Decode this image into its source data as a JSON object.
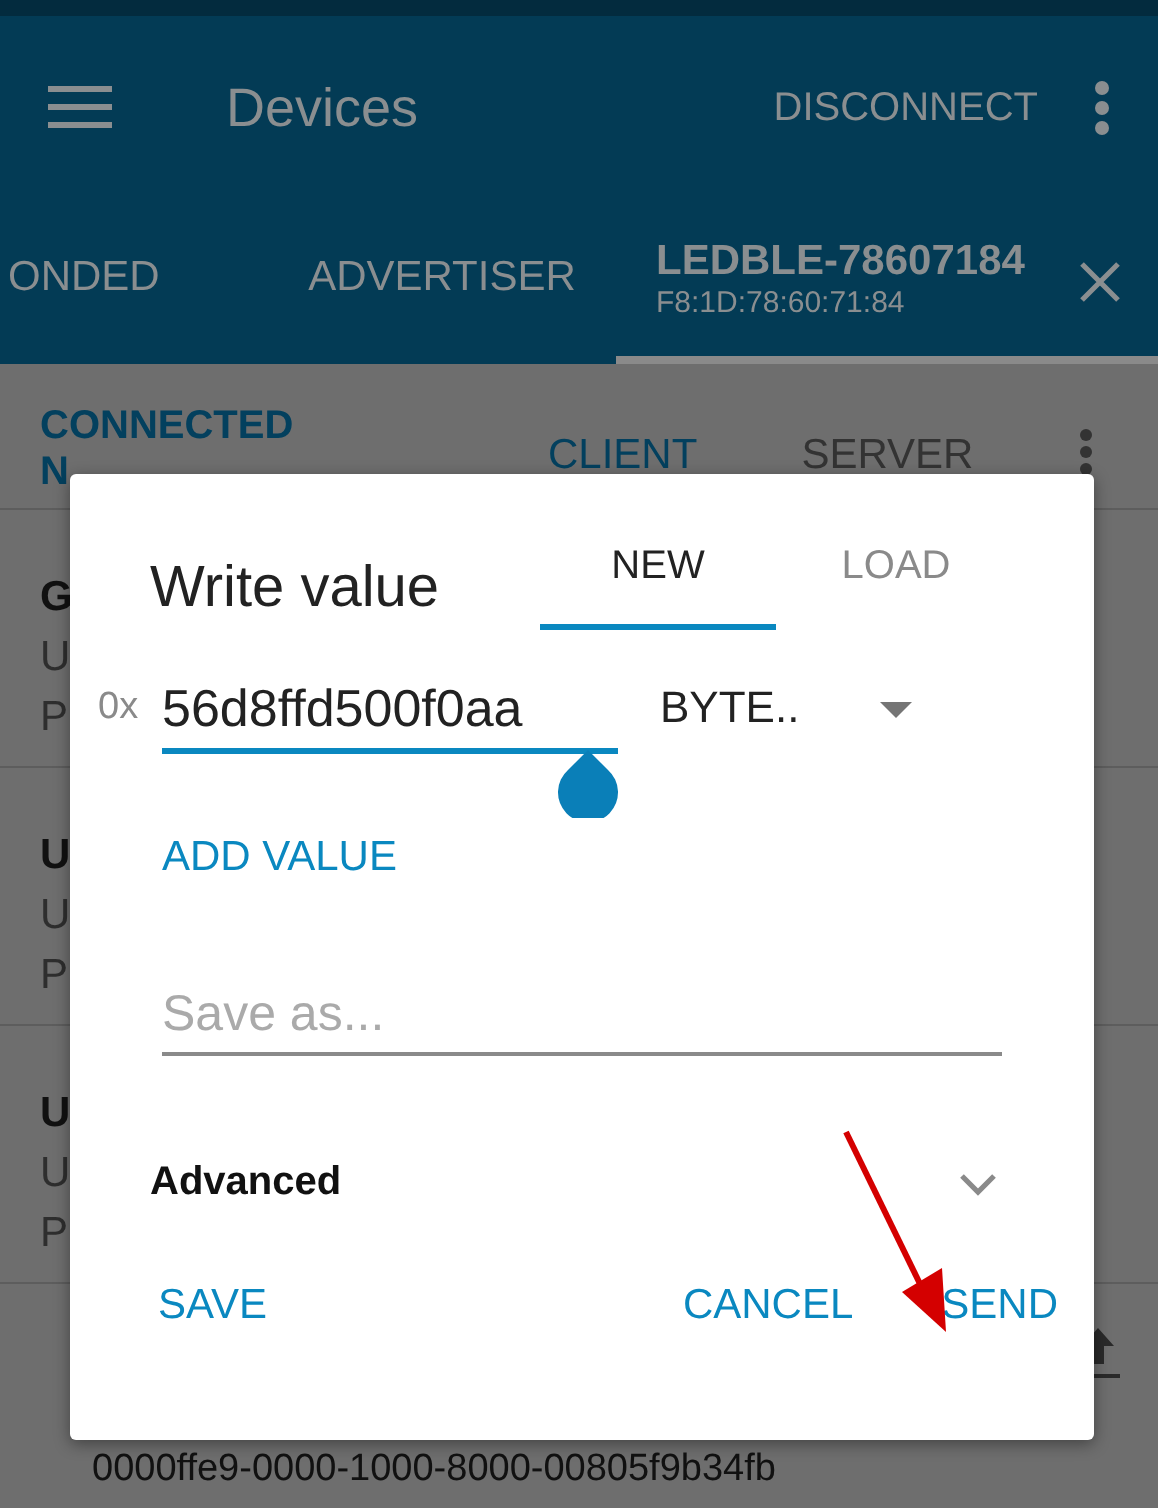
{
  "app_bar": {
    "title": "Devices",
    "action": "DISCONNECT"
  },
  "tabs": [
    {
      "label": "ONDED",
      "selected": false
    },
    {
      "label": "ADVERTISER",
      "selected": false
    },
    {
      "label": "LEDBLE-78607184",
      "subtitle": "F8:1D:78:60:71:84",
      "selected": true
    }
  ],
  "connection": {
    "status": "CONNECTED",
    "status_2": "N",
    "modes": [
      {
        "label": "CLIENT",
        "selected": true
      },
      {
        "label": "SERVER",
        "selected": false
      }
    ]
  },
  "rows": [
    {
      "name": "G",
      "line_1": "U",
      "line_2": "P"
    },
    {
      "name": "U",
      "line_1": "U",
      "line_2": "P"
    },
    {
      "name": "U",
      "line_1": "U",
      "line_2": "P"
    }
  ],
  "footer_uuid": "0000ffe9-0000-1000-8000-00805f9b34fb",
  "dialog": {
    "title": "Write value",
    "tabs": [
      {
        "label": "NEW",
        "selected": true
      },
      {
        "label": "LOAD",
        "selected": false
      }
    ],
    "prefix": "0x",
    "value": "56d8ffd500f0aa",
    "format": "BYTE..",
    "add_button": "ADD VALUE",
    "save_placeholder": "Save as...",
    "advanced": "Advanced",
    "advanced_expanded": false,
    "buttons": [
      {
        "label": "SAVE"
      },
      {
        "label": "CANCEL"
      },
      {
        "label": "SEND"
      }
    ]
  }
}
